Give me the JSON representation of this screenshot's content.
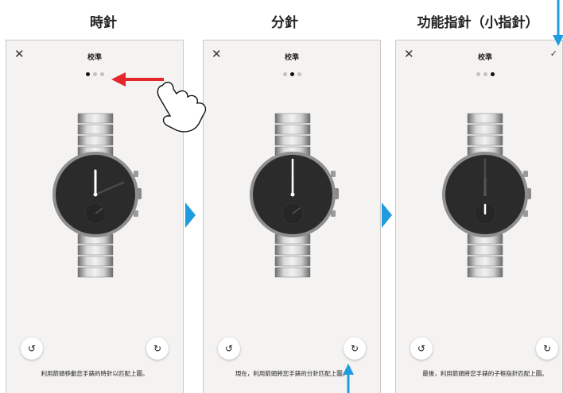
{
  "headings": [
    "時針",
    "分針",
    "功能指針（小指針）"
  ],
  "panels": [
    {
      "title": "校準",
      "close_icon": "close-icon",
      "active_dot": 0,
      "caption": "利用箭頭移動您手錶的時針以匹配上圖。",
      "left_button_icon": "rotate-icon",
      "right_button_icon": "rotate-icon",
      "left_button_glyph": "↺",
      "right_button_glyph": "↻"
    },
    {
      "title": "校準",
      "close_icon": "close-icon",
      "active_dot": 1,
      "caption": "現在，利用箭頭將您手錶的分針匹配上圖。",
      "left_button_icon": "rotate-icon",
      "right_button_icon": "rotate-icon",
      "left_button_glyph": "↺",
      "right_button_glyph": "↻"
    },
    {
      "title": "校準",
      "close_icon": "close-icon",
      "confirm_icon": "check-icon",
      "active_dot": 2,
      "caption": "最後，利用箭頭將您手錶的子框指針匹配上圖。",
      "left_button_icon": "rotate-icon",
      "right_button_icon": "rotate-icon",
      "left_button_glyph": "↺",
      "right_button_glyph": "↻"
    }
  ],
  "glyphs": {
    "close": "✕",
    "check": "✓"
  },
  "colors": {
    "accent_blue": "#1e9cde",
    "swipe_arrow_red": "#e3262b",
    "dial": "#2b2b2b",
    "hand": "#ffffff",
    "screen_bg": "#f4f3f1"
  }
}
